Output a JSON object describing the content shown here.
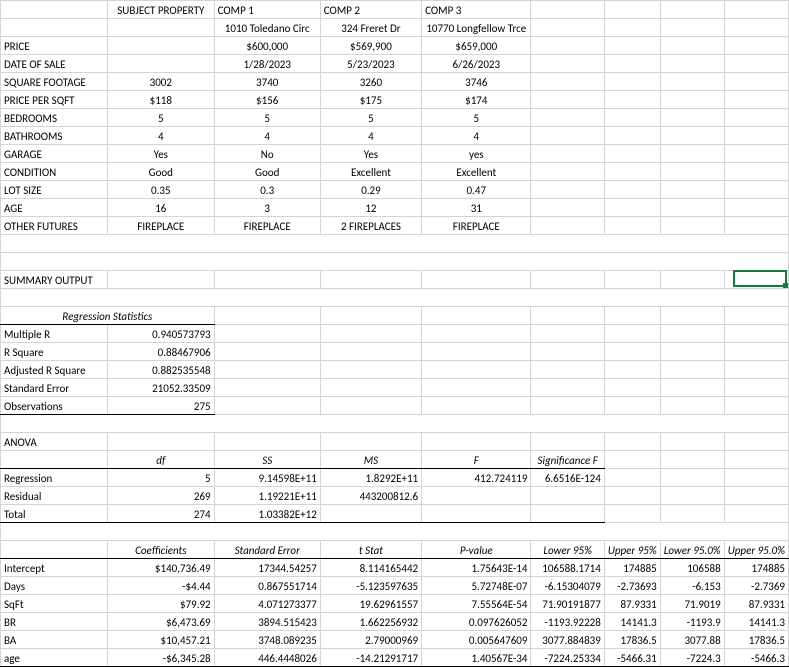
{
  "headers": {
    "subject": "SUBJECT PROPERTY",
    "comp1": "COMP 1",
    "comp2": "COMP 2",
    "comp3": "COMP 3"
  },
  "addr": {
    "comp1": "1010 Toledano Circ",
    "comp2": "324 Freret Dr",
    "comp3": "10770 Longfellow Trce"
  },
  "rows": [
    {
      "label": "PRICE",
      "subject": "",
      "c1": "$600,000",
      "c2": "$569,900",
      "c3": "$659,000"
    },
    {
      "label": "DATE OF SALE",
      "subject": "",
      "c1": "1/28/2023",
      "c2": "5/23/2023",
      "c3": "6/26/2023"
    },
    {
      "label": "SQUARE FOOTAGE",
      "subject": "3002",
      "c1": "3740",
      "c2": "3260",
      "c3": "3746"
    },
    {
      "label": "PRICE PER SQFT",
      "subject": "$118",
      "c1": "$156",
      "c2": "$175",
      "c3": "$174"
    },
    {
      "label": "BEDROOMS",
      "subject": "5",
      "c1": "5",
      "c2": "5",
      "c3": "5"
    },
    {
      "label": "BATHROOMS",
      "subject": "4",
      "c1": "4",
      "c2": "4",
      "c3": "4"
    },
    {
      "label": "GARAGE",
      "subject": "Yes",
      "c1": "No",
      "c2": "Yes",
      "c3": "yes"
    },
    {
      "label": "CONDITION",
      "subject": "Good",
      "c1": "Good",
      "c2": "Excellent",
      "c3": "Excellent"
    },
    {
      "label": "LOT SIZE",
      "subject": "0.35",
      "c1": "0.3",
      "c2": "0.29",
      "c3": "0.47"
    },
    {
      "label": "AGE",
      "subject": "16",
      "c1": "3",
      "c2": "12",
      "c3": "31"
    },
    {
      "label": "OTHER FUTURES",
      "subject": "FIREPLACE",
      "c1": "FIREPLACE",
      "c2": "2 FIREPLACES",
      "c3": "FIREPLACE"
    }
  ],
  "summary_title": "SUMMARY OUTPUT",
  "reg_stats_title": "Regression Statistics",
  "reg_stats": [
    {
      "label": "Multiple R",
      "val": "0.940573793"
    },
    {
      "label": "R Square",
      "val": "0.88467906"
    },
    {
      "label": "Adjusted R Square",
      "val": "0.882535548"
    },
    {
      "label": "Standard Error",
      "val": "21052.33509"
    },
    {
      "label": "Observations",
      "val": "275"
    }
  ],
  "anova_title": "ANOVA",
  "anova_head": {
    "df": "df",
    "ss": "SS",
    "ms": "MS",
    "f": "F",
    "sig": "Significance F"
  },
  "anova": [
    {
      "label": "Regression",
      "df": "5",
      "ss": "9.14598E+11",
      "ms": "1.8292E+11",
      "f": "412.724119",
      "sig": "6.6516E-124"
    },
    {
      "label": "Residual",
      "df": "269",
      "ss": "1.19221E+11",
      "ms": "443200812.6",
      "f": "",
      "sig": ""
    },
    {
      "label": "Total",
      "df": "274",
      "ss": "1.03382E+12",
      "ms": "",
      "f": "",
      "sig": ""
    }
  ],
  "coef_head": {
    "coef": "Coefficients",
    "se": "Standard Error",
    "t": "t Stat",
    "p": "P-value",
    "lo": "Lower 95%",
    "up": "Upper 95%",
    "lo2": "Lower 95.0%",
    "up2": "Upper 95.0%"
  },
  "coef": [
    {
      "label": "Intercept",
      "coef": "$140,736.49",
      "se": "17344.54257",
      "t": "8.114165442",
      "p": "1.75643E-14",
      "lo": "106588.1714",
      "up": "174885",
      "lo2": "106588",
      "up2": "174885"
    },
    {
      "label": "Days",
      "coef": "-$4.44",
      "se": "0.867551714",
      "t": "-5.123597635",
      "p": "5.72748E-07",
      "lo": "-6.15304079",
      "up": "-2.73693",
      "lo2": "-6.153",
      "up2": "-2.7369"
    },
    {
      "label": "SqFt",
      "coef": "$79.92",
      "se": "4.071273377",
      "t": "19.62961557",
      "p": "7.55564E-54",
      "lo": "71.90191877",
      "up": "87.9331",
      "lo2": "71.9019",
      "up2": "87.9331"
    },
    {
      "label": "BR",
      "coef": "$6,473.69",
      "se": "3894.515423",
      "t": "1.662256932",
      "p": "0.097626052",
      "lo": "-1193.92228",
      "up": "14141.3",
      "lo2": "-1193.9",
      "up2": "14141.3"
    },
    {
      "label": "BA",
      "coef": "$10,457.21",
      "se": "3748.089235",
      "t": "2.79000969",
      "p": "0.005647609",
      "lo": "3077.884839",
      "up": "17836.5",
      "lo2": "3077.88",
      "up2": "17836.5"
    },
    {
      "label": "age",
      "coef": "-$6,345.28",
      "se": "446.4448026",
      "t": "-14.21291717",
      "p": "1.40567E-34",
      "lo": "-7224.25334",
      "up": "-5466.31",
      "lo2": "-7224.3",
      "up2": "-5466.3"
    }
  ]
}
